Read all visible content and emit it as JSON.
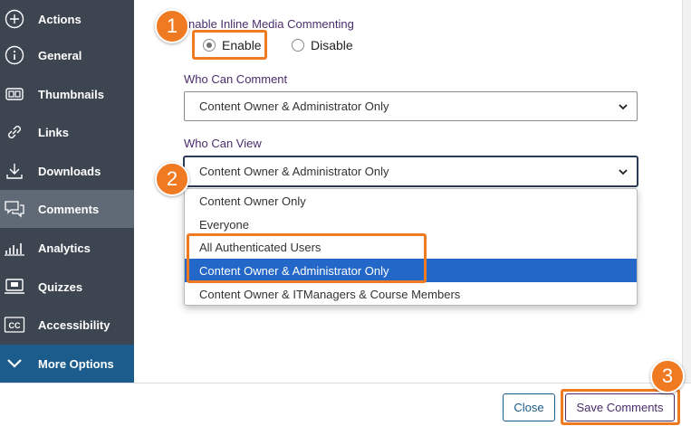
{
  "sidebar": {
    "items": [
      {
        "label": "Actions",
        "icon": "plus-circle-icon"
      },
      {
        "label": "General",
        "icon": "info-icon"
      },
      {
        "label": "Thumbnails",
        "icon": "thumbnails-icon"
      },
      {
        "label": "Links",
        "icon": "link-icon"
      },
      {
        "label": "Downloads",
        "icon": "download-icon"
      },
      {
        "label": "Comments",
        "icon": "comments-icon"
      },
      {
        "label": "Analytics",
        "icon": "analytics-icon"
      },
      {
        "label": "Quizzes",
        "icon": "quiz-icon"
      },
      {
        "label": "Accessibility",
        "icon": "cc-icon"
      }
    ],
    "more_options": "More Options",
    "active": "Comments"
  },
  "form": {
    "enable_label": "nable Inline Media Commenting",
    "enable_option": "Enable",
    "disable_option": "Disable",
    "enabled": true,
    "who_can_comment_label": "Who Can Comment",
    "who_can_comment_value": "Content Owner & Administrator Only",
    "who_can_view_label": "Who Can View",
    "who_can_view_value": "Content Owner & Administrator Only",
    "view_options": [
      "Content Owner Only",
      "Everyone",
      "All Authenticated Users",
      "Content Owner & Administrator Only",
      "Content Owner & ITManagers & Course Members"
    ],
    "selected_option": "Content Owner & Administrator Only"
  },
  "buttons": {
    "close": "Close",
    "save": "Save Comments"
  },
  "callouts": [
    "1",
    "2",
    "3"
  ],
  "colors": {
    "sidebar_bg": "#3c4550",
    "active_bg": "#5f6a76",
    "more_bg": "#1b5c8d",
    "label_purple": "#4a2d6b",
    "selected_blue": "#2367c8",
    "callout_orange": "#f07a22"
  }
}
